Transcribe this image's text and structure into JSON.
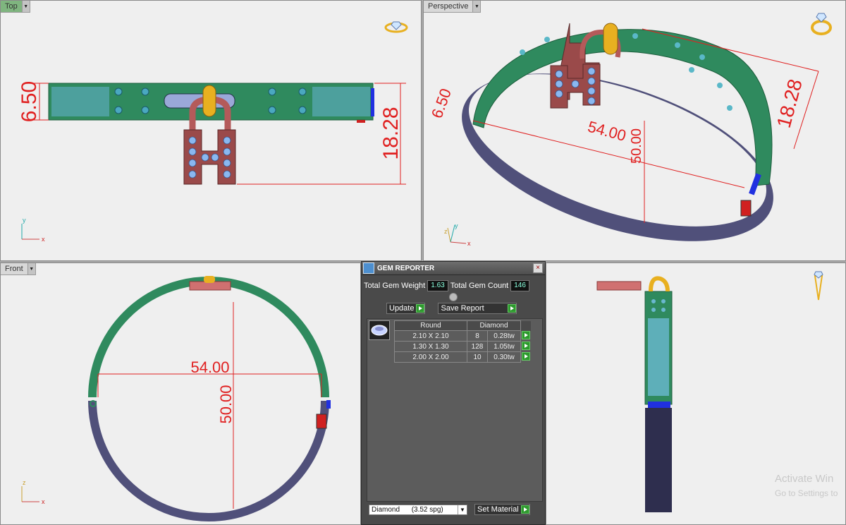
{
  "viewports": {
    "top": {
      "label": "Top",
      "dim_width": "6.50",
      "dim_height": "18.28",
      "axis_a": "y",
      "axis_b": "x"
    },
    "perspective": {
      "label": "Perspective",
      "dim_a": "6.50",
      "dim_b": "54.00",
      "dim_c": "50.00",
      "dim_d": "18.28",
      "axis_a": "z",
      "axis_b": "y",
      "axis_c": "x"
    },
    "front": {
      "label": "Front",
      "dim_width": "54.00",
      "dim_height": "50.00",
      "axis_a": "z",
      "axis_b": "x"
    }
  },
  "gem_reporter": {
    "title": "GEM REPORTER",
    "total_weight_label": "Total Gem Weight",
    "total_weight": "1.63",
    "total_count_label": "Total Gem Count",
    "total_count": "146",
    "update_label": "Update",
    "save_report_label": "Save Report",
    "header": {
      "shape": "Round",
      "material": "Diamond"
    },
    "rows": [
      {
        "size": "2.10 X 2.10",
        "count": "8",
        "weight": "0.28tw"
      },
      {
        "size": "1.30 X 1.30",
        "count": "128",
        "weight": "1.05tw"
      },
      {
        "size": "2.00 X 2.00",
        "count": "10",
        "weight": "0.30tw"
      }
    ],
    "material_select": "Diamond      (3.52 spg)",
    "set_material_label": "Set Material"
  },
  "watermark": {
    "line1": "Activate Win",
    "line2": "Go to Settings to"
  },
  "colors": {
    "band_green": "#2f8a5e",
    "band_purple": "#50507a",
    "dimension_red": "#e02020",
    "lock_red": "#9a4a4a",
    "gold": "#e8b020",
    "gem_blue": "#8ab8f0"
  }
}
